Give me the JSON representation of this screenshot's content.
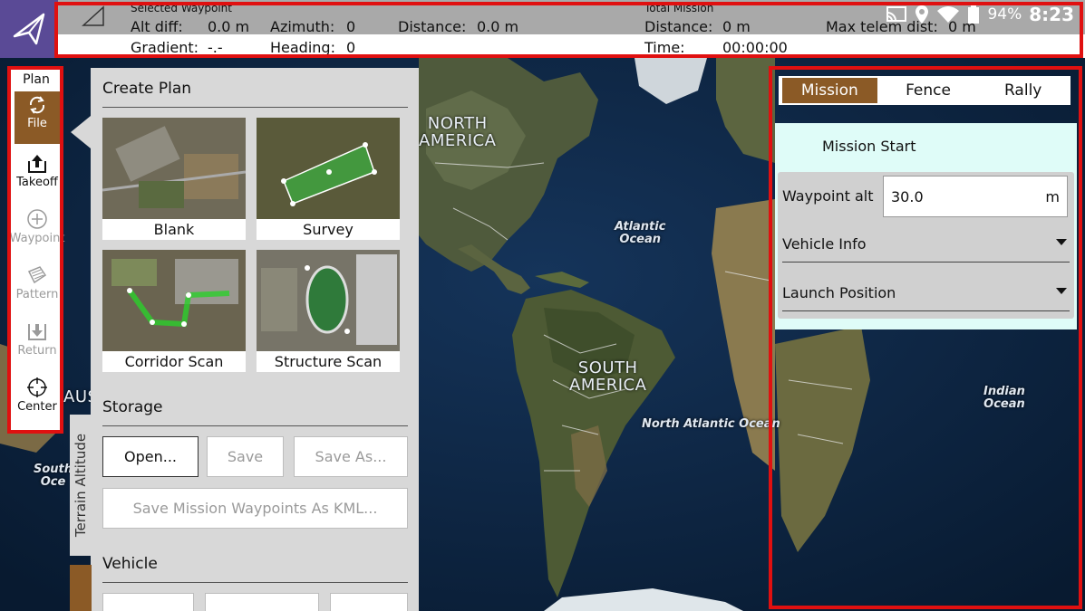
{
  "status_bar": {
    "selected_waypoint": {
      "title": "Selected Waypoint",
      "alt_diff_label": "Alt diff:",
      "alt_diff_value": "0.0 m",
      "azimuth_label": "Azimuth:",
      "azimuth_value": "0",
      "distance_label": "Distance:",
      "distance_value": "0.0 m",
      "gradient_label": "Gradient:",
      "gradient_value": "-.-",
      "heading_label": "Heading:",
      "heading_value": "0"
    },
    "total_mission": {
      "title": "Total Mission",
      "distance_label": "Distance:",
      "distance_value": "0 m",
      "time_label": "Time:",
      "time_value": "00:00:00",
      "max_telem_label": "Max telem dist:",
      "max_telem_value": "0 m"
    },
    "system": {
      "battery_pct": "94%",
      "clock": "8:23"
    }
  },
  "plan_toolbar": {
    "title": "Plan",
    "items": [
      {
        "label": "File",
        "icon": "sync-icon",
        "state": "active"
      },
      {
        "label": "Takeoff",
        "icon": "takeoff-icon",
        "state": "enabled"
      },
      {
        "label": "Waypoint",
        "icon": "plus-circle-icon",
        "state": "disabled"
      },
      {
        "label": "Pattern",
        "icon": "pattern-icon",
        "state": "disabled"
      },
      {
        "label": "Return",
        "icon": "return-icon",
        "state": "disabled"
      },
      {
        "label": "Center",
        "icon": "crosshair-icon",
        "state": "enabled"
      }
    ]
  },
  "file_panel": {
    "create_plan_title": "Create Plan",
    "templates": [
      "Blank",
      "Survey",
      "Corridor Scan",
      "Structure Scan"
    ],
    "storage_title": "Storage",
    "storage_buttons": {
      "open": "Open...",
      "save": "Save",
      "save_as": "Save As...",
      "save_kml": "Save Mission Waypoints As KML..."
    },
    "vehicle_title": "Vehicle",
    "terrain_tab": "Terrain Altitude"
  },
  "mission_panel": {
    "tabs": [
      {
        "label": "Mission",
        "active": true
      },
      {
        "label": "Fence",
        "active": false
      },
      {
        "label": "Rally",
        "active": false
      }
    ],
    "mission_start": "Mission Start",
    "waypoint_alt_label": "Waypoint alt",
    "waypoint_alt_value": "30.0",
    "waypoint_alt_unit": "m",
    "sections": [
      "Vehicle Info",
      "Launch Position"
    ]
  },
  "map_labels": {
    "north_america": "NORTH\nAMERICA",
    "south_america": "SOUTH\nAMERICA",
    "atlantic": "Atlantic\nOcean",
    "north_atlantic": "North Atlantic Ocean",
    "indian": "Indian\nOcean",
    "south_ocean_partial": "South\nOce",
    "aust_partial": "AUST"
  },
  "colors": {
    "accent": "#8b5a26",
    "highlight_box": "#e01010",
    "mission_body": "#dffcf8",
    "logo": "#5a4a96"
  }
}
